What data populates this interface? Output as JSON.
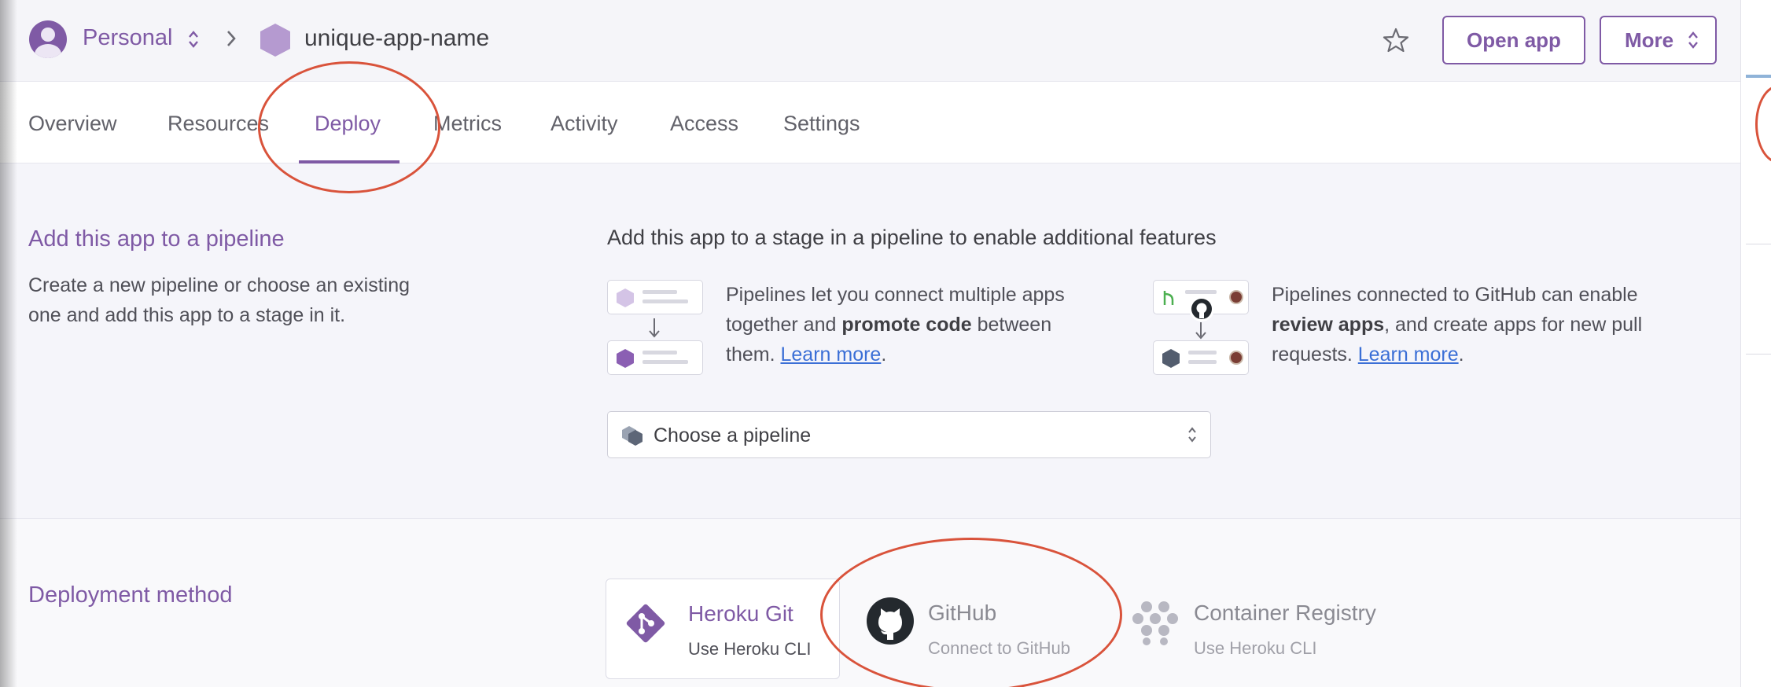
{
  "header": {
    "account": "Personal",
    "app_name": "unique-app-name",
    "open_app_label": "Open app",
    "more_label": "More"
  },
  "tabs": [
    {
      "label": "Overview",
      "active": false
    },
    {
      "label": "Resources",
      "active": false
    },
    {
      "label": "Deploy",
      "active": true
    },
    {
      "label": "Metrics",
      "active": false
    },
    {
      "label": "Activity",
      "active": false
    },
    {
      "label": "Access",
      "active": false
    },
    {
      "label": "Settings",
      "active": false
    }
  ],
  "pipeline": {
    "title": "Add this app to a pipeline",
    "description": "Create a new pipeline or choose an existing one and add this app to a stage in it.",
    "headline": "Add this app to a stage in a pipeline to enable additional features",
    "feature1": {
      "pre": "Pipelines let you connect multiple apps together and ",
      "bold": "promote code",
      "post": " between them. ",
      "link": "Learn more",
      "end": "."
    },
    "feature2": {
      "pre": "Pipelines connected to GitHub can enable ",
      "bold": "review apps",
      "post": ", and create apps for new pull requests. ",
      "link": "Learn more",
      "end": "."
    },
    "select_value": "Choose a pipeline"
  },
  "deployment": {
    "title": "Deployment method",
    "methods": [
      {
        "name": "Heroku Git",
        "sub": "Use Heroku CLI",
        "selected": true,
        "icon": "heroku-git-icon"
      },
      {
        "name": "GitHub",
        "sub": "Connect to GitHub",
        "selected": false,
        "icon": "github-icon"
      },
      {
        "name": "Container Registry",
        "sub": "Use Heroku CLI",
        "selected": false,
        "icon": "container-registry-icon"
      }
    ]
  },
  "colors": {
    "accent": "#7f5aa5",
    "annotation": "#d9533b",
    "link": "#3b6fd6"
  }
}
